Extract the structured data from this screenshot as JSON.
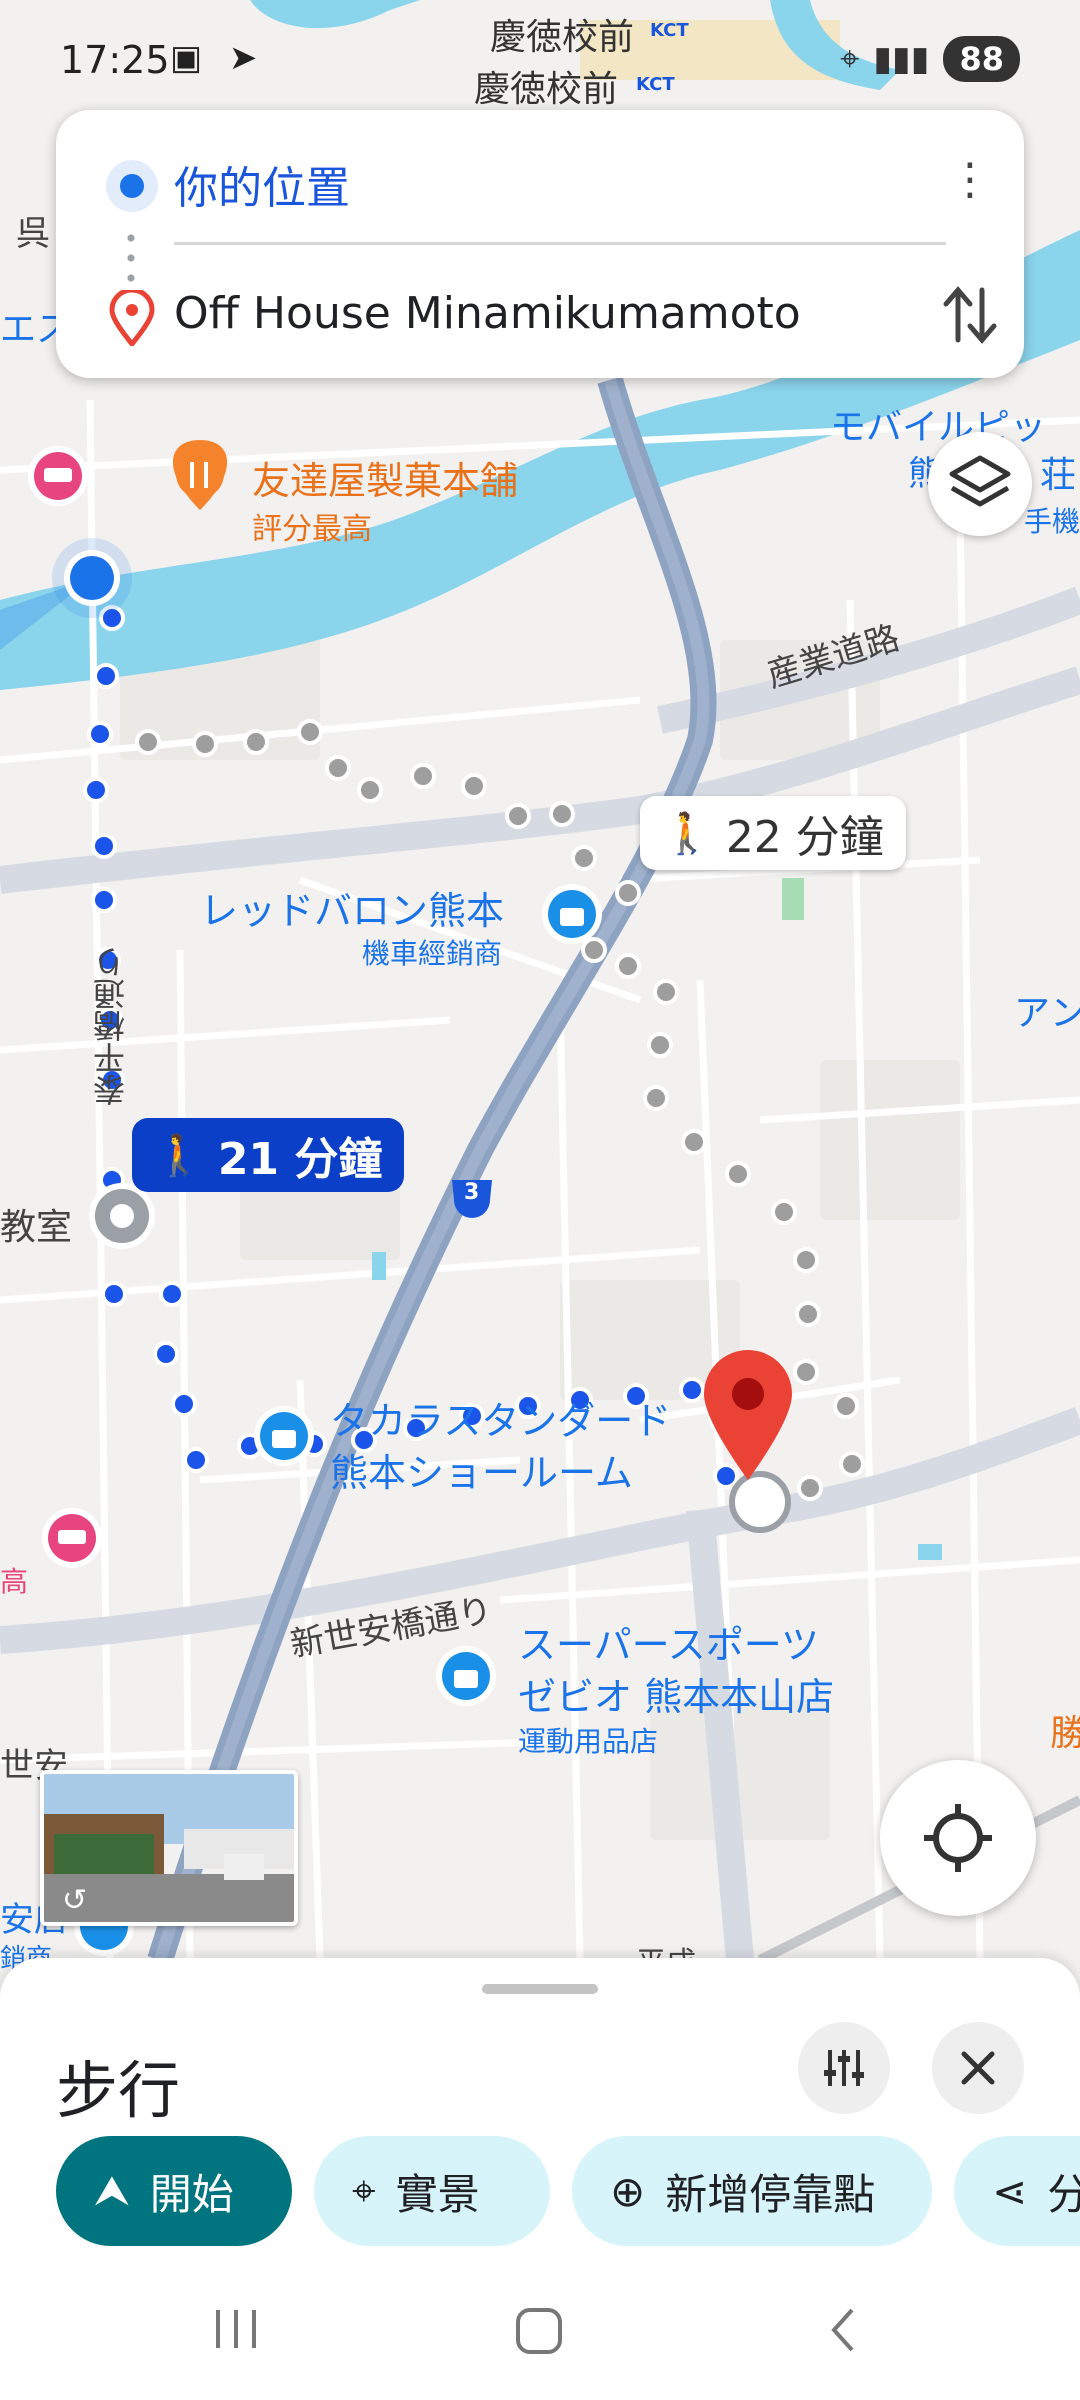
{
  "status_bar": {
    "time": "17:25",
    "battery": "88"
  },
  "directions": {
    "from": "你的位置",
    "to": "Off House Minamikumamoto"
  },
  "route_bubbles": {
    "selected": "21 分鐘",
    "alternate": "22 分鐘"
  },
  "map_labels": {
    "keitoku1": "慶徳校前",
    "keitoku2": "慶徳校前",
    "kct": "KCT",
    "tomodachi": "友達屋製菓本舗",
    "tomodachi_sub": "評分最高",
    "mobile": "モバイルピッ",
    "sangyo": "産業道路",
    "red_baron": "レッドバロン熊本",
    "red_baron_sub": "機車經銷商",
    "taihei": "泰平橋通り",
    "takara1": "タカラスタンダード",
    "takara2": "熊本ショールーム",
    "shinseian": "新世安橋通り",
    "super1": "スーパースポーツ",
    "super2": "ゼビオ 熊本本山店",
    "super_sub": "運動用品店",
    "route3": "3",
    "kyoushitsu": "教室",
    "heisei": "平成",
    "left_fragment1": "呉",
    "left_fragment2": "エス",
    "left_fragment3": "世安",
    "left_fragment4": "安店",
    "left_fragment5": "銷商",
    "left_fragment6": "高",
    "right_fragment1": "荘",
    "right_fragment2": "手機",
    "right_fragment3": "アン",
    "right_fragment4": "勝",
    "right_fragment5": "熊"
  },
  "sheet": {
    "title": "步行",
    "chips": [
      "開始",
      "實景",
      "新增停靠點",
      "分"
    ]
  },
  "colors": {
    "route_blue": "#1a54e8",
    "alt_route_grey": "#9e9e9e",
    "river": "#8ad4ec",
    "start_chip": "#00747f",
    "chip_bg": "#d7f4fa",
    "destination_pin": "#ea4335"
  }
}
